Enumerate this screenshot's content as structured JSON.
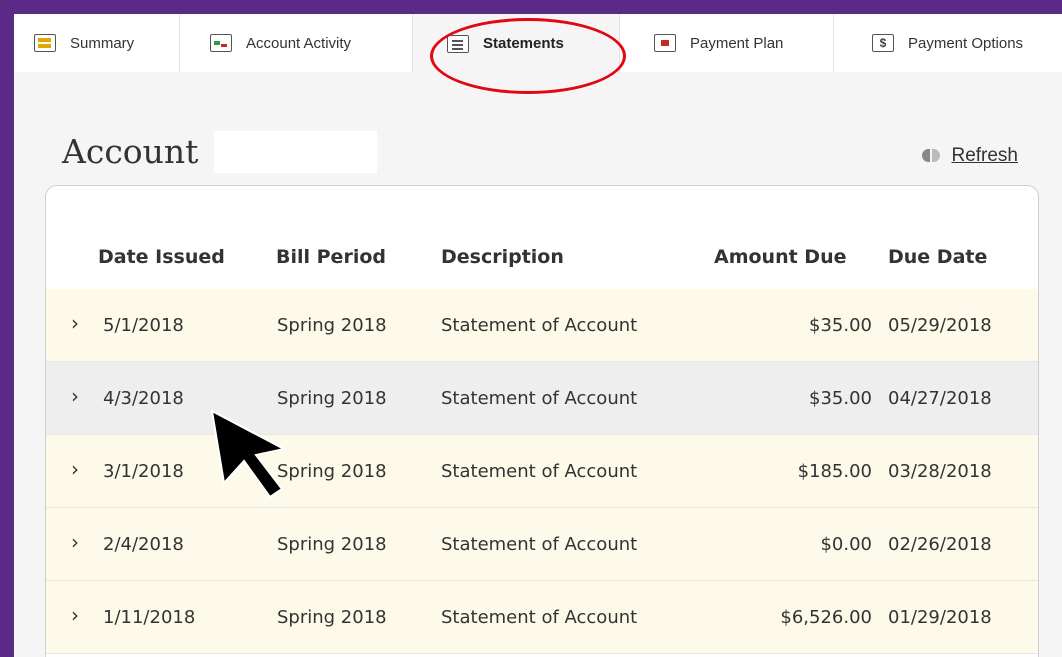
{
  "tabs": [
    {
      "label": "Summary",
      "icon": "summary-icon"
    },
    {
      "label": "Account Activity",
      "icon": "account-activity-icon"
    },
    {
      "label": "Statements",
      "icon": "statements-icon"
    },
    {
      "label": "Payment Plan",
      "icon": "payment-plan-icon"
    },
    {
      "label": "Payment Options",
      "icon": "payment-options-icon"
    }
  ],
  "active_tab": "Statements",
  "payment_options_icon_glyph": "$",
  "page": {
    "title": "Account",
    "refresh_label": "Refresh"
  },
  "table": {
    "columns": [
      "Date Issued",
      "Bill Period",
      "Description",
      "Amount Due",
      "Due Date"
    ],
    "rows": [
      {
        "date_issued": "5/1/2018",
        "bill_period": "Spring 2018",
        "description": "Statement of Account",
        "amount_due": "$35.00",
        "due_date": "05/29/2018"
      },
      {
        "date_issued": "4/3/2018",
        "bill_period": "Spring 2018",
        "description": "Statement of Account",
        "amount_due": "$35.00",
        "due_date": "04/27/2018"
      },
      {
        "date_issued": "3/1/2018",
        "bill_period": "Spring 2018",
        "description": "Statement of Account",
        "amount_due": "$185.00",
        "due_date": "03/28/2018"
      },
      {
        "date_issued": "2/4/2018",
        "bill_period": "Spring 2018",
        "description": "Statement of Account",
        "amount_due": "$0.00",
        "due_date": "02/26/2018"
      },
      {
        "date_issued": "1/11/2018",
        "bill_period": "Spring 2018",
        "description": "Statement of Account",
        "amount_due": "$6,526.00",
        "due_date": "01/29/2018"
      }
    ]
  },
  "colors": {
    "frame_background": "#5b2a86",
    "highlight_ring": "#e30613",
    "row_background": "#fdfaea",
    "row_hover": "#eeeeee"
  }
}
